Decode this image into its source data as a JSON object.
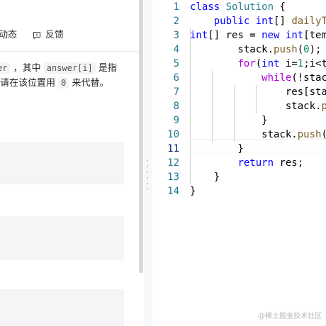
{
  "problem_pane": {
    "tabs": {
      "activity": "动态",
      "feedback": "反馈"
    },
    "description": {
      "line1_chip_cut": "er",
      "line1_text_a": "，其中",
      "line1_chip": "answer[i]",
      "line1_text_b": "是指",
      "line2_text_a": "请在该位置用",
      "line2_chip": "0",
      "line2_text_b": "来代替。"
    }
  },
  "editor": {
    "line_numbers": [
      "1",
      "2",
      "3",
      "4",
      "5",
      "6",
      "7",
      "8",
      "9",
      "10",
      "11",
      "12",
      "13",
      "14"
    ],
    "active_line": 11
  },
  "watermark": "@稀土掘金技术社区",
  "colors": {
    "keyword": "#0000ff",
    "type": "#267f99",
    "function": "#795e26",
    "number": "#098658",
    "control": "#af00db",
    "line_number": "#237893"
  }
}
